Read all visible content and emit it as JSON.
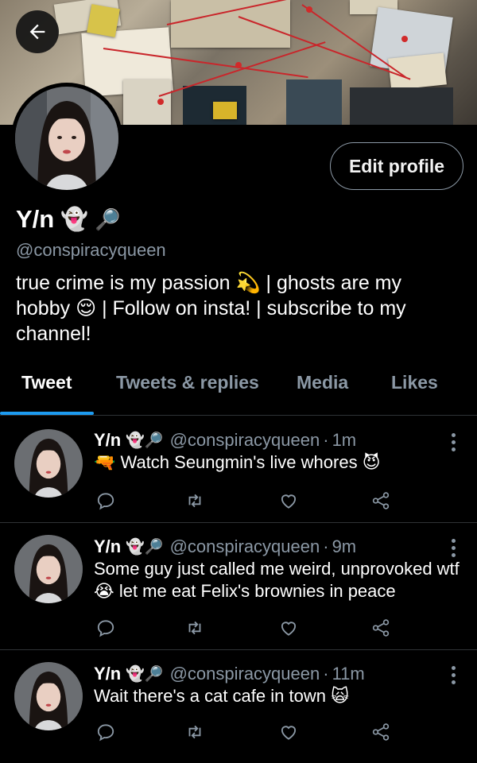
{
  "header": {
    "back_icon": "arrow-left-icon",
    "edit_profile_label": "Edit profile"
  },
  "profile": {
    "display_name": "Y/n",
    "name_emojis": [
      "👻",
      "🔎"
    ],
    "handle": "@conspiracyqueen",
    "bio_parts": [
      "true crime is my passion ",
      "💫",
      " | ghosts are my hobby ",
      "😌",
      " | Follow on insta! | subscribe to my channel!"
    ]
  },
  "tabs": [
    {
      "label": "Tweet",
      "active": true
    },
    {
      "label": "Tweets & replies",
      "active": false
    },
    {
      "label": "Media",
      "active": false
    },
    {
      "label": "Likes",
      "active": false
    }
  ],
  "tweets": [
    {
      "name": "Y/n",
      "name_emojis": "👻🔎",
      "handle": "@conspiracyqueen",
      "time": "1m",
      "text": "🔫 Watch Seungmin's live whores 😈"
    },
    {
      "name": "Y/n",
      "name_emojis": "👻🔎",
      "handle": "@conspiracyqueen",
      "time": "9m",
      "text": "Some guy just called me weird, unprovoked wtf 😭 let me eat Felix's brownies in peace"
    },
    {
      "name": "Y/n",
      "name_emojis": "👻🔎",
      "handle": "@conspiracyqueen",
      "time": "11m",
      "text": "Wait there's a cat cafe in town 🙀"
    }
  ],
  "colors": {
    "accent": "#1d9bf0",
    "muted": "#8b98a5",
    "divider": "#2f3336",
    "background": "#000000"
  }
}
